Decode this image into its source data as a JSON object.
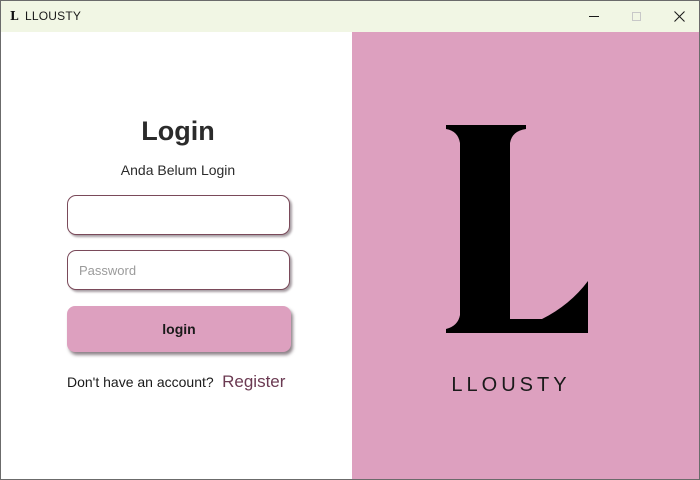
{
  "window": {
    "icon_letter": "L",
    "title": "LLOUSTY",
    "controls": {
      "minimize": "minimize-icon",
      "maximize": "maximize-icon",
      "close": "close-icon"
    }
  },
  "login": {
    "title": "Login",
    "subtitle": "Anda Belum Login",
    "username_value": "",
    "username_placeholder": "",
    "password_value": "",
    "password_placeholder": "Password",
    "button_label": "login",
    "no_account_text": "Don't have an account?",
    "register_link": "Register"
  },
  "brand": {
    "logo_icon": "llousty-l-logo",
    "name": "LLOUSTY"
  },
  "colors": {
    "titlebar_bg": "#f1f6e4",
    "accent_pink": "#dda0bf",
    "register_link": "#6b3a52",
    "input_border": "#7a4a5a"
  }
}
